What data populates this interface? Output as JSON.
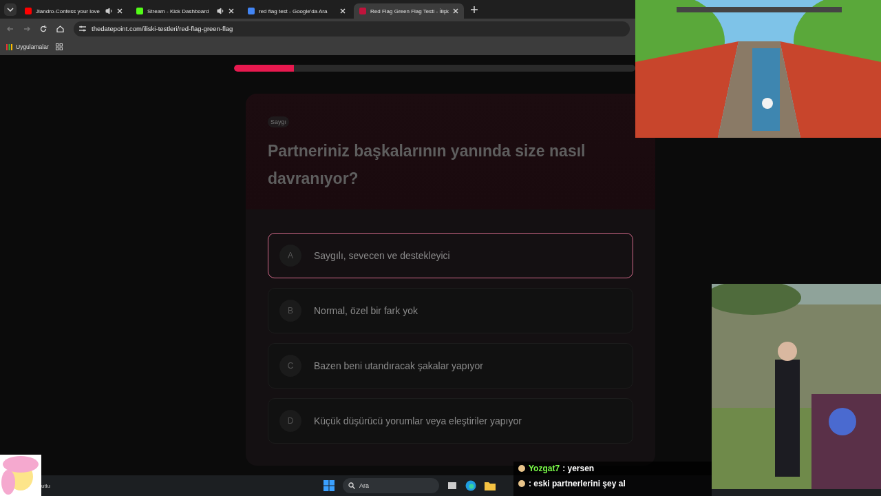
{
  "browser": {
    "tabs": [
      {
        "title": "Jiandro-Confess your love",
        "color": "#ff0000",
        "audio": true,
        "selected": false
      },
      {
        "title": "Stream - Kick Dashboard",
        "color": "#53fc18",
        "audio": true,
        "selected": false
      },
      {
        "title": "red flag test - Google'da Ara",
        "color": "#4285f4",
        "audio": false,
        "selected": false
      },
      {
        "title": "Red Flag Green Flag Testi - İlişk",
        "color": "#c0143c",
        "audio": false,
        "selected": true
      }
    ],
    "url": "thedatepoint.com/iliski-testleri/red-flag-green-flag",
    "bookmarks": [
      "Uygulamalar"
    ]
  },
  "quiz": {
    "progress": {
      "level": 0.15
    },
    "category": "Saygı",
    "question": "Partneriniz başkalarının yanında size nasıl davranıyor?",
    "options": [
      {
        "letter": "A",
        "text": "Saygılı, sevecen ve destekleyici",
        "selected": true
      },
      {
        "letter": "B",
        "text": "Normal, özel bir fark yok",
        "selected": false
      },
      {
        "letter": "C",
        "text": "Bazen beni utandıracak şakalar yapıyor",
        "selected": false
      },
      {
        "letter": "D",
        "text": "Küçük düşürücü yorumlar veya eleştiriler yapıyor",
        "selected": false
      }
    ]
  },
  "taskbar": {
    "weather_text": "utlu",
    "search_placeholder": "Ara"
  },
  "overlay": {
    "chat": [
      {
        "user": "Yozgat7",
        "message": ": yersen"
      },
      {
        "message": ": eski partnerlerini şey al"
      }
    ]
  }
}
